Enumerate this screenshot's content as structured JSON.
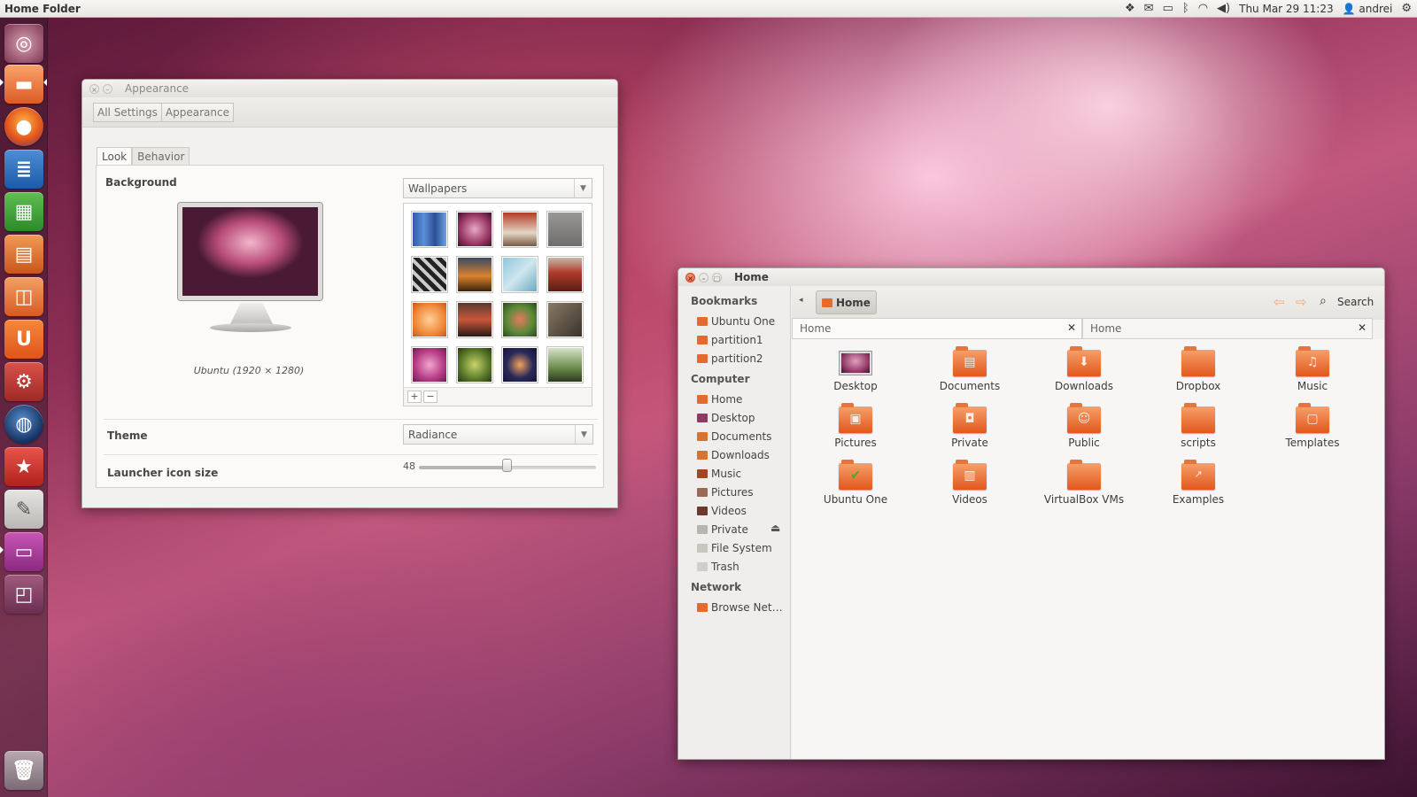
{
  "top_panel": {
    "app_title": "Home Folder",
    "datetime": "Thu Mar 29 11:23",
    "user": "andrei",
    "indicators": [
      "dropbox-icon",
      "mail-icon",
      "battery-icon",
      "bluetooth-icon",
      "wifi-icon",
      "volume-icon"
    ]
  },
  "launcher": {
    "items": [
      "dash",
      "files",
      "firefox",
      "writer",
      "calc",
      "impress",
      "software-center",
      "ubuntu-one",
      "system-settings",
      "shotwell-globe",
      "app-store",
      "text-editor",
      "appearance",
      "workspace-switcher",
      "trash"
    ]
  },
  "appearance": {
    "title": "Appearance",
    "breadcrumbs": [
      "All Settings",
      "Appearance"
    ],
    "tabs": [
      "Look",
      "Behavior"
    ],
    "background_label": "Background",
    "background_caption": "Ubuntu (1920 × 1280)",
    "source": "Wallpapers",
    "theme_label": "Theme",
    "theme_value": "Radiance",
    "launcher_size_label": "Launcher icon size",
    "launcher_size_value": "48",
    "launcher_size_fraction": 0.48
  },
  "home": {
    "title": "Home",
    "path_button": "Home",
    "search_label": "Search",
    "tabs": [
      "Home",
      "Home"
    ],
    "sidebar": {
      "bookmarks_header": "Bookmarks",
      "bookmarks": [
        "Ubuntu One",
        "partition1",
        "partition2"
      ],
      "computer_header": "Computer",
      "computer": [
        "Home",
        "Desktop",
        "Documents",
        "Downloads",
        "Music",
        "Pictures",
        "Videos",
        "Private",
        "File System",
        "Trash"
      ],
      "network_header": "Network",
      "network": [
        "Browse Net…"
      ]
    },
    "files": [
      "Desktop",
      "Documents",
      "Downloads",
      "Dropbox",
      "Music",
      "Pictures",
      "Private",
      "Public",
      "scripts",
      "Templates",
      "Ubuntu One",
      "Videos",
      "VirtualBox VMs",
      "Examples"
    ]
  },
  "colors": {
    "accent": "#e2571c",
    "panel": "#ebe9e5"
  }
}
